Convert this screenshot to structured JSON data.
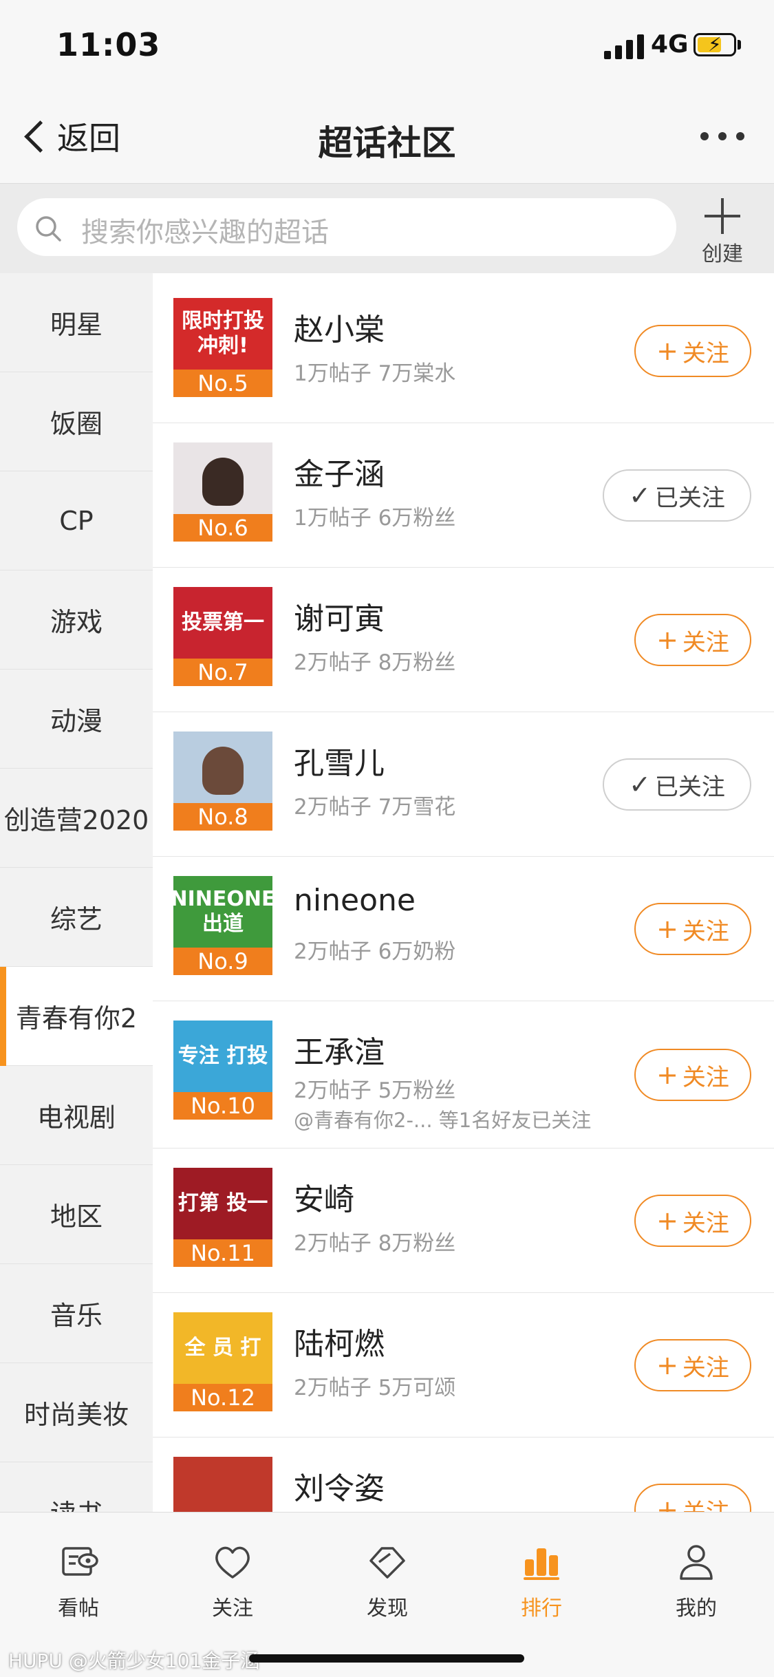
{
  "status_bar": {
    "time": "11:03",
    "network": "4G"
  },
  "nav": {
    "back_label": "返回",
    "title": "超话社区"
  },
  "search": {
    "placeholder": "搜索你感兴趣的超话",
    "create_label": "创建"
  },
  "categories": [
    {
      "label": "明星",
      "active": false
    },
    {
      "label": "饭圈",
      "active": false
    },
    {
      "label": "CP",
      "active": false
    },
    {
      "label": "游戏",
      "active": false
    },
    {
      "label": "动漫",
      "active": false
    },
    {
      "label": "创造营2020",
      "active": false
    },
    {
      "label": "综艺",
      "active": false
    },
    {
      "label": "青春有你2",
      "active": true
    },
    {
      "label": "电视剧",
      "active": false
    },
    {
      "label": "地区",
      "active": false
    },
    {
      "label": "音乐",
      "active": false
    },
    {
      "label": "时尚美妆",
      "active": false
    },
    {
      "label": "读书",
      "active": false
    }
  ],
  "topics": [
    {
      "rank": "No.5",
      "name": "赵小棠",
      "meta": "1万帖子 7万棠水",
      "followed": false,
      "follow_label": "关注",
      "art": "限时打投 冲刺!",
      "color": "#d42a2a"
    },
    {
      "rank": "No.6",
      "name": "金子涵",
      "meta": "1万帖子 6万粉丝",
      "followed": true,
      "follow_label": "已关注",
      "art": "",
      "color": "#e9e4e6"
    },
    {
      "rank": "No.7",
      "name": "谢可寅",
      "meta": "2万帖子 8万粉丝",
      "followed": false,
      "follow_label": "关注",
      "art": "投票第一",
      "color": "#c8242f"
    },
    {
      "rank": "No.8",
      "name": "孔雪儿",
      "meta": "2万帖子 7万雪花",
      "followed": true,
      "follow_label": "已关注",
      "art": "",
      "color": "#b9cde0"
    },
    {
      "rank": "No.9",
      "name": "nineone",
      "meta": "2万帖子 6万奶粉",
      "followed": false,
      "follow_label": "关注",
      "art": "NINEONE 出道",
      "color": "#3f9a3c"
    },
    {
      "rank": "No.10",
      "name": "王承渲",
      "meta": "2万帖子 5万粉丝",
      "friend": "@青春有你2-... 等1名好友已关注",
      "followed": false,
      "follow_label": "关注",
      "art": "专注 打投",
      "color": "#3ba7d8"
    },
    {
      "rank": "No.11",
      "name": "安崎",
      "meta": "2万帖子 8万粉丝",
      "followed": false,
      "follow_label": "关注",
      "art": "打第 投一",
      "color": "#9e1b24"
    },
    {
      "rank": "No.12",
      "name": "陆柯燃",
      "meta": "2万帖子 5万可颂",
      "followed": false,
      "follow_label": "关注",
      "art": "全 员 打",
      "color": "#f2b728"
    },
    {
      "rank": "",
      "name": "刘令姿",
      "meta": "",
      "followed": false,
      "follow_label": "关注",
      "art": "",
      "color": "#c0392b"
    }
  ],
  "tabs": [
    {
      "label": "看帖",
      "icon": "post-icon",
      "active": false
    },
    {
      "label": "关注",
      "icon": "heart-icon",
      "active": false
    },
    {
      "label": "发现",
      "icon": "diamond-icon",
      "active": false
    },
    {
      "label": "排行",
      "icon": "ranking-icon",
      "active": true
    },
    {
      "label": "我的",
      "icon": "profile-icon",
      "active": false
    }
  ],
  "watermark": "HUPU @火箭少女101金子涵"
}
